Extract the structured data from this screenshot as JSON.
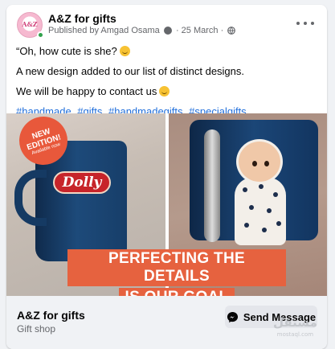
{
  "post": {
    "page_name": "A&Z for gifts",
    "published_by": "Published by Amgad Osama",
    "separator": "·",
    "date": "25 March",
    "avatar_logo": "A&Z",
    "globe_icon": "globe-icon",
    "more_icon": "more-options-icon",
    "lines": [
      "“Oh, how cute is she?",
      "A new design added to our list of distinct designs.",
      "We will be happy to contact us"
    ],
    "hashtags": [
      "#handmade",
      "#gifts",
      "#handmadegifts",
      "#specialgifts"
    ]
  },
  "media": {
    "badge_title": "NEW EDITION!",
    "badge_sub": "Available now",
    "mug_name": "Dolly",
    "banner_line1": "PERFECTING THE DETAILS",
    "banner_line2": "IS OUR GOAL"
  },
  "footer": {
    "page_name": "A&Z for gifts",
    "category": "Gift shop",
    "send_label": "Send Message"
  },
  "watermark": {
    "text": "مستقل",
    "sub": "mostaql.com"
  },
  "colors": {
    "link": "#216fdb",
    "secondary_text": "#65676b",
    "banner": "#e6623f",
    "online": "#31a24c"
  }
}
